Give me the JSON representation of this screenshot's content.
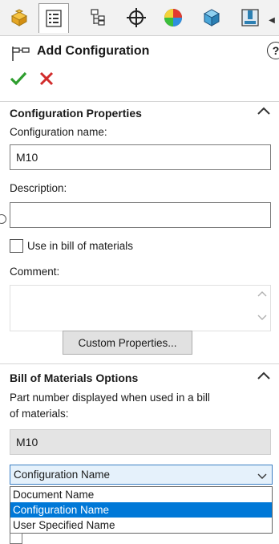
{
  "tabs": [
    {
      "icon": "feature-manager-icon"
    },
    {
      "icon": "property-manager-icon"
    },
    {
      "icon": "configuration-manager-icon"
    },
    {
      "icon": "dimxpert-manager-icon"
    },
    {
      "icon": "display-manager-icon"
    },
    {
      "icon": "cam-feature-manager-icon"
    },
    {
      "icon": "cam-operation-manager-icon"
    }
  ],
  "header": {
    "title": "Add Configuration",
    "help": "?"
  },
  "config_props": {
    "title": "Configuration Properties",
    "name_label": "Configuration name:",
    "name_value": "M10",
    "desc_label": "Description:",
    "desc_value": "",
    "bom_checkbox_label": "Use in bill of materials",
    "bom_checked": false,
    "comment_label": "Comment:",
    "comment_value": "",
    "custom_props_button": "Custom Properties..."
  },
  "bom_options": {
    "title": "Bill of Materials Options",
    "desc_line1": "Part number displayed when used in a bill",
    "desc_line2": "of materials:",
    "part_number": "M10",
    "selected": "Configuration Name",
    "options": [
      "Document Name",
      "Configuration Name",
      "User Specified Name"
    ]
  },
  "colors": {
    "accent": "#0078d7",
    "ok": "#2e9e2e",
    "cancel": "#d12b2b"
  }
}
